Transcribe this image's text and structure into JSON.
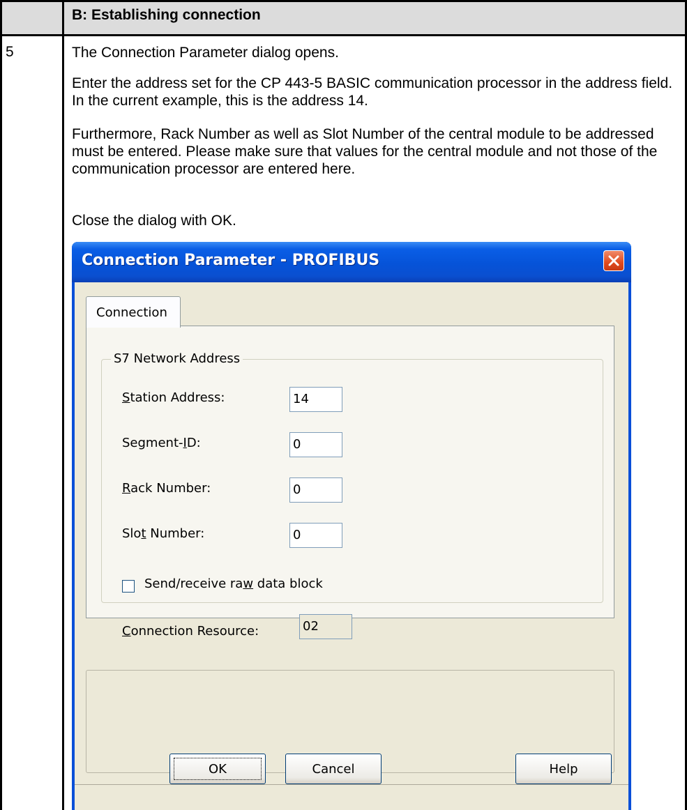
{
  "document": {
    "section_title": "B: Establishing connection",
    "step_number": "5",
    "paragraphs": [
      "The Connection Parameter dialog opens.",
      "Enter the address set for the CP 443-5 BASIC communication processor in the  address field. In the current example, this is the address 14.",
      "Furthermore, Rack Number as well as Slot Number of the central module to be addressed must be entered. Please make sure that values for the central module and not those of the communication processor are entered here.",
      "Close the dialog with OK."
    ]
  },
  "dialog": {
    "title": "Connection Parameter - PROFIBUS",
    "tab": "Connection",
    "group_title": "S7 Network Address",
    "fields": {
      "station_address": {
        "label_pre": "",
        "label_ul": "S",
        "label_post": "tation Address:",
        "value": "14"
      },
      "segment_id": {
        "label_pre": "Segment-",
        "label_ul": "I",
        "label_post": "D:",
        "value": "0"
      },
      "rack_number": {
        "label_pre": "",
        "label_ul": "R",
        "label_post": "ack Number:",
        "value": "0"
      },
      "slot_number": {
        "label_pre": "Slo",
        "label_ul": "t",
        "label_post": " Number:",
        "value": "0"
      }
    },
    "checkbox": {
      "label_pre": "Send/receive ra",
      "label_ul": "w",
      "label_post": " data block",
      "checked": false
    },
    "connection_resource": {
      "label_pre": "",
      "label_ul": "C",
      "label_post": "onnection Resource:",
      "value": "02"
    },
    "buttons": {
      "ok": "OK",
      "cancel": "Cancel",
      "help": "Help"
    },
    "colors": {
      "title_bar": "#0a5ee6",
      "close_button": "#e04a1e",
      "dialog_face": "#ece9d8"
    }
  }
}
